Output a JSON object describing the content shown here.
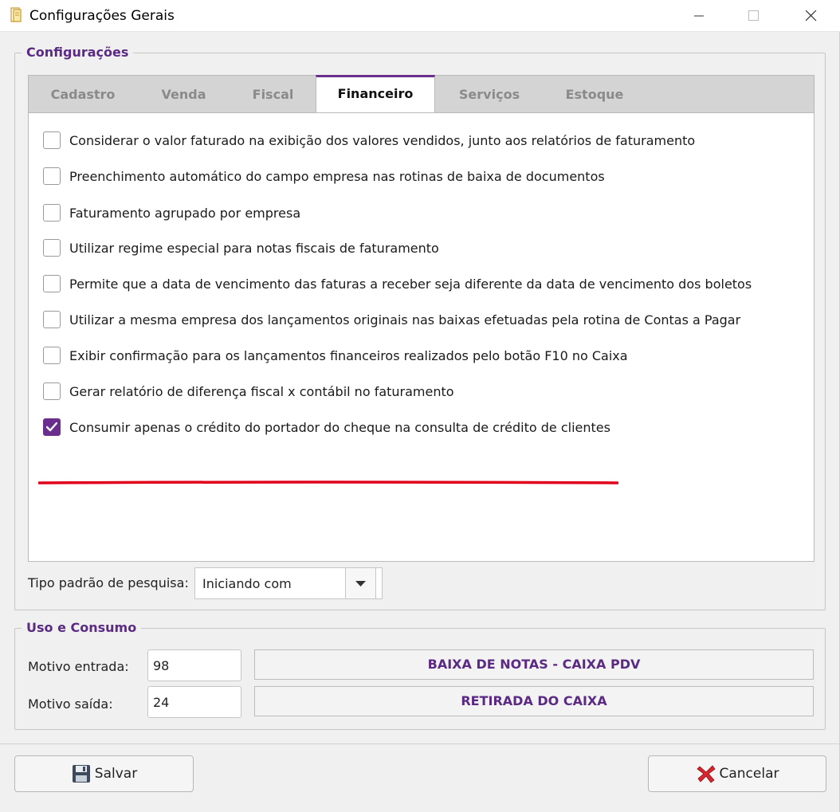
{
  "window": {
    "title": "Configurações Gerais"
  },
  "config_group": {
    "legend": "Configurações",
    "tabs": [
      {
        "label": "Cadastro",
        "active": false
      },
      {
        "label": "Venda",
        "active": false
      },
      {
        "label": "Fiscal",
        "active": false
      },
      {
        "label": "Financeiro",
        "active": true
      },
      {
        "label": "Serviços",
        "active": false
      },
      {
        "label": "Estoque",
        "active": false
      }
    ],
    "options": [
      {
        "label": "Considerar o valor faturado na exibição dos valores vendidos, junto aos relatórios de faturamento",
        "checked": false
      },
      {
        "label": "Preenchimento automático do campo empresa nas rotinas de baixa de documentos",
        "checked": false
      },
      {
        "label": "Faturamento agrupado por empresa",
        "checked": false
      },
      {
        "label": "Utilizar regime especial para notas fiscais de faturamento",
        "checked": false
      },
      {
        "label": "Permite que a data de vencimento das faturas a receber seja diferente da data de vencimento dos boletos",
        "checked": false
      },
      {
        "label": "Utilizar a mesma empresa dos lançamentos originais nas baixas efetuadas pela rotina de Contas a Pagar",
        "checked": false
      },
      {
        "label": "Exibir confirmação para os lançamentos financeiros realizados pelo botão F10 no Caixa",
        "checked": false
      },
      {
        "label": "Gerar relatório de diferença fiscal x contábil no faturamento",
        "checked": false
      },
      {
        "label": "Consumir apenas o crédito do portador do cheque na consulta de crédito de clientes",
        "checked": true
      }
    ],
    "search_type": {
      "label": "Tipo padrão de pesquisa:",
      "value": "Iniciando com"
    }
  },
  "uso_group": {
    "legend": "Uso e Consumo",
    "entrada": {
      "label": "Motivo entrada:",
      "code": "98",
      "description": "BAIXA DE NOTAS - CAIXA PDV"
    },
    "saida": {
      "label": "Motivo saída:",
      "code": "24",
      "description": "RETIRADA DO CAIXA"
    }
  },
  "footer": {
    "save_label": "Salvar",
    "cancel_label": "Cancelar"
  },
  "colors": {
    "accent": "#6a2f8c",
    "highlight_underline": "#e0001b"
  }
}
